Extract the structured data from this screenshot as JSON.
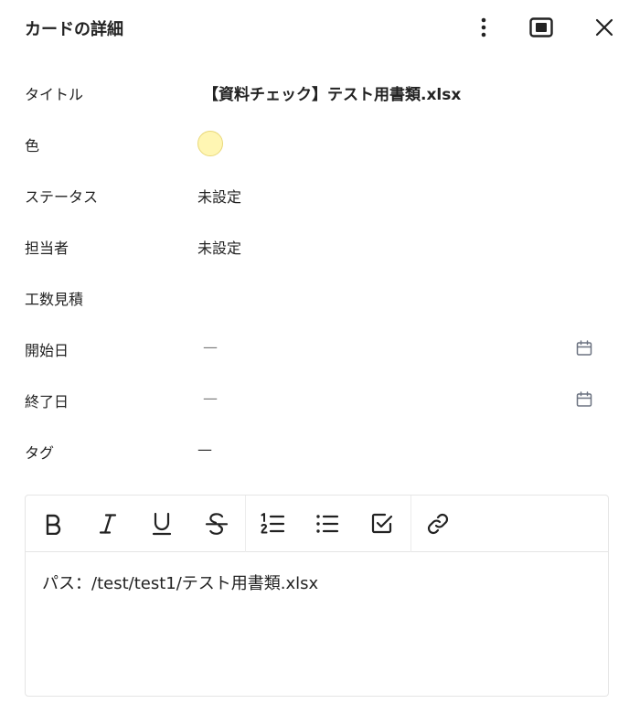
{
  "header": {
    "title": "カードの詳細",
    "icons": {
      "more": "more-vertical-icon",
      "expand": "expand-square-icon",
      "close": "close-icon"
    }
  },
  "fields": {
    "title": {
      "label": "タイトル",
      "value": "【資料チェック】テスト用書類.xlsx"
    },
    "color": {
      "label": "色",
      "swatch": "#fff6b3"
    },
    "status": {
      "label": "ステータス",
      "value": "未設定"
    },
    "assignee": {
      "label": "担当者",
      "value": "未設定"
    },
    "estimate": {
      "label": "工数見積",
      "value": ""
    },
    "start_date": {
      "label": "開始日",
      "value": "—"
    },
    "end_date": {
      "label": "終了日",
      "value": "—"
    },
    "tags": {
      "label": "タグ",
      "value": "—"
    }
  },
  "editor": {
    "toolbar": [
      "bold-icon",
      "italic-icon",
      "underline-icon",
      "strikethrough-icon",
      "ordered-list-icon",
      "bullet-list-icon",
      "checklist-icon",
      "link-icon"
    ],
    "content": "パス：/test/test1/テスト用書類.xlsx"
  },
  "colors": {
    "text": "#222222",
    "border": "#e5e5e5",
    "icon_muted": "#6b7280"
  }
}
